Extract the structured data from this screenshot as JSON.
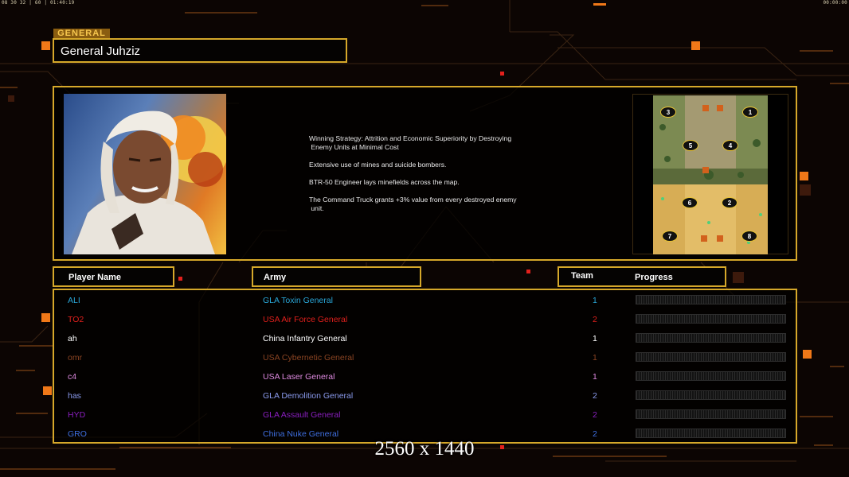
{
  "hud": {
    "top_left": "08 30 32 | 60 | 01:40:19",
    "top_right": "00:00:00"
  },
  "general": {
    "tag": "GENERAL",
    "name": "General Juhziz",
    "portrait_icon": "general-portrait-icon",
    "description": [
      "Winning Strategy: Attrition and Economic Superiority by Destroying\n Enemy Units at Minimal Cost",
      "Extensive use of mines and suicide bombers.",
      "BTR-50 Engineer lays minefields across the map.",
      "The Command Truck grants +3% value from every destroyed enemy\n unit."
    ]
  },
  "minimap": {
    "icon": "minimap-icon",
    "slots": [
      "1",
      "2",
      "3",
      "4",
      "5",
      "6",
      "7",
      "8"
    ]
  },
  "columns": {
    "player_name": "Player Name",
    "army": "Army",
    "team": "Team",
    "progress": "Progress"
  },
  "players": [
    {
      "name": "ALI",
      "army": "GLA Toxin General",
      "team": "1",
      "color": "#2aa7d8",
      "progress": 0
    },
    {
      "name": "TO2",
      "army": "USA Air Force General",
      "team": "2",
      "color": "#e0201c",
      "progress": 0
    },
    {
      "name": "ah",
      "army": "China Infantry General",
      "team": "1",
      "color": "#ffffff",
      "progress": 0
    },
    {
      "name": "omr",
      "army": "USA Cybernetic General",
      "team": "1",
      "color": "#8a4422",
      "progress": 0
    },
    {
      "name": "c4",
      "army": "USA Laser General",
      "team": "1",
      "color": "#df8ae0",
      "progress": 0
    },
    {
      "name": "has",
      "army": "GLA Demolition General",
      "team": "2",
      "color": "#8a9aec",
      "progress": 0
    },
    {
      "name": "HYD",
      "army": "GLA Assault General",
      "team": "2",
      "color": "#8a1fbf",
      "progress": 0
    },
    {
      "name": "GRO",
      "army": "China Nuke General",
      "team": "2",
      "color": "#3f6fe0",
      "progress": 0
    }
  ],
  "resolution_label": "2560 x 1440",
  "colors": {
    "accent_gold": "#d6a82a",
    "hud_orange": "#f07818"
  }
}
